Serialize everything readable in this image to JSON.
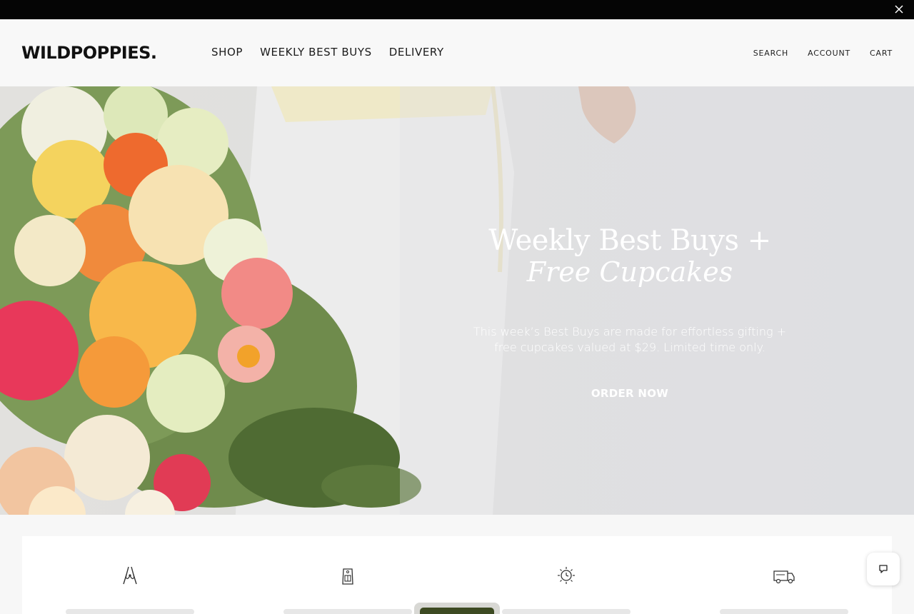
{
  "brand": {
    "logo": "WILDPOPPIES."
  },
  "nav": {
    "items": [
      "SHOP",
      "WEEKLY BEST BUYS",
      "DELIVERY"
    ]
  },
  "utils": {
    "search": "SEARCH",
    "account": "ACCOUNT",
    "cart": "CART"
  },
  "hero": {
    "title": "Weekly Best Buys +",
    "title_italic": "Free Cupcakes",
    "subtitle_line1": "This week’s Best Buys are made for effortless gifting +",
    "subtitle_line2": "free cupcakes valued at $29. Limited time only.",
    "cta": "ORDER NOW"
  },
  "features": [
    {
      "icon": "secateurs-icon"
    },
    {
      "icon": "gift-tag-icon"
    },
    {
      "icon": "sun-clock-icon"
    },
    {
      "icon": "delivery-van-icon"
    }
  ],
  "colors": {
    "topbar": "#050505",
    "header_bg": "#f8f8f8",
    "page_bg": "#f7f7f7",
    "popup_accent": "#3d4a22"
  }
}
